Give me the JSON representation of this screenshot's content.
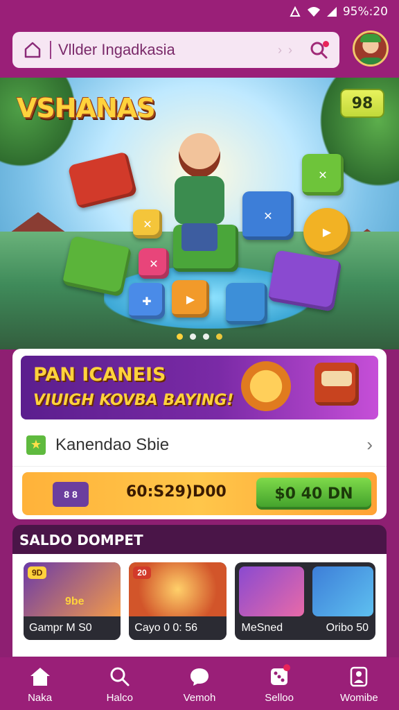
{
  "status_bar": {
    "indicators": "ᚼ",
    "battery_text": "95%⁠:20"
  },
  "header": {
    "search_value": "Vllder Ingadkasia",
    "search_placeholder": "Vllder Ingadkasia"
  },
  "hero": {
    "logo_text": "VSHANAS",
    "counter": "98",
    "dots_count": 4,
    "active_dot": 1
  },
  "promo": {
    "line1": "PAN ICANEIS",
    "line2": "VIUIGH KOVBA BAYING!"
  },
  "list_row": {
    "label": "Kanendao Sbie"
  },
  "claim": {
    "chest_text": "8 8",
    "amount": "60:S29)D00",
    "button_label": "$0 40 DN"
  },
  "saldo": {
    "title": "SALDO DOMPET",
    "games": [
      {
        "tag": "9D",
        "label": "Gampr M S0",
        "art_text": "9be"
      },
      {
        "tag": "20",
        "label": "Cayo 0 0: 56",
        "art_text": ""
      },
      {
        "tag": "",
        "label": "MeSned",
        "art_text": ""
      },
      {
        "tag": "",
        "label": "Oribo 50",
        "art_text": ""
      }
    ]
  },
  "nav": {
    "items": [
      {
        "label": "Naka",
        "icon": "home-icon"
      },
      {
        "label": "Halco",
        "icon": "search-icon"
      },
      {
        "label": "Vemoh",
        "icon": "chat-icon"
      },
      {
        "label": "Selloo",
        "icon": "dice-icon"
      },
      {
        "label": "Womibe",
        "icon": "user-icon"
      }
    ]
  },
  "colors": {
    "brand": "#9a1f78",
    "accent": "#ffd23c",
    "claim_green": "#3f9e2a"
  }
}
